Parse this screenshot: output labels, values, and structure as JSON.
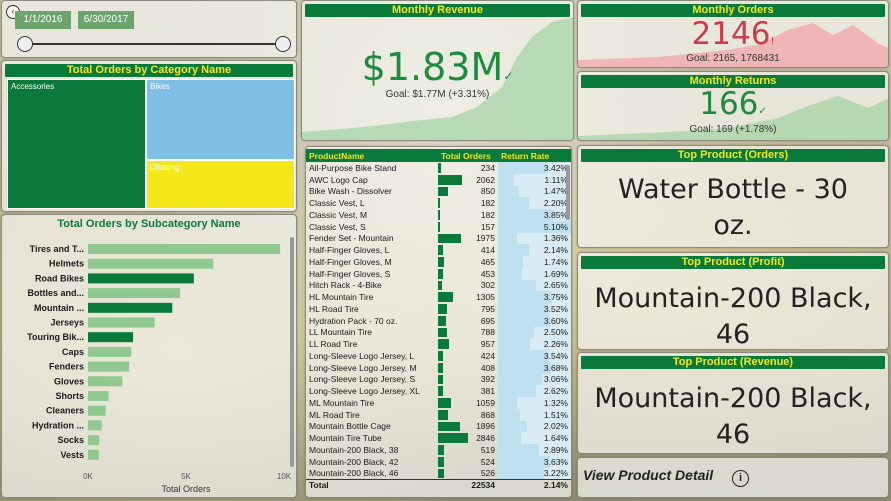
{
  "slicer": {
    "start_date": "1/1/2016",
    "end_date": "6/30/2017"
  },
  "revenue": {
    "title": "Monthly Revenue",
    "value": "$1.83M",
    "goal": "Goal: $1.77M (+3.31%)"
  },
  "orders": {
    "title": "Monthly Orders",
    "value": "2146",
    "goal": "Goal: 2165, 1768431"
  },
  "returns": {
    "title": "Monthly Returns",
    "value": "166",
    "goal": "Goal: 169 (+1.78%)"
  },
  "category": {
    "title": "Total Orders by Category Name",
    "items": [
      "Accessories",
      "Bikes",
      "Clothing"
    ],
    "colors": {
      "accessories": "#0a7a3a",
      "bikes": "#7fbfe6",
      "clothing": "#f4e81a"
    }
  },
  "subcategory": {
    "title": "Total Orders by Subcategory Name",
    "xlabel": "Total Orders",
    "ticks": [
      "0K",
      "5K",
      "10K"
    ]
  },
  "chart_data": {
    "type": "bar",
    "categories": [
      "Tires and T...",
      "Helmets",
      "Road Bikes",
      "Bottles and...",
      "Mountain ...",
      "Jerseys",
      "Touring Bik...",
      "Caps",
      "Fenders",
      "Gloves",
      "Shorts",
      "Cleaners",
      "Hydration ...",
      "Socks",
      "Vests"
    ],
    "values": [
      9800,
      6400,
      5400,
      4700,
      4300,
      3400,
      2300,
      2200,
      2100,
      1750,
      1050,
      900,
      700,
      570,
      550
    ],
    "highlight": [
      false,
      false,
      true,
      false,
      true,
      false,
      true,
      false,
      false,
      false,
      false,
      false,
      false,
      false,
      false
    ],
    "xlabel": "Total Orders",
    "xlim": [
      0,
      10000
    ],
    "ticks": [
      "0K",
      "5K",
      "10K"
    ]
  },
  "product_table": {
    "headers": [
      "ProductName",
      "Total Orders",
      "Return Rate"
    ],
    "max_orders": 2530,
    "max_rr": 5.1,
    "rows": [
      {
        "name": "All-Purpose Bike Stand",
        "orders": "234",
        "orders_num": 234,
        "rr": "3.42%",
        "rr_num": 3.42
      },
      {
        "name": "AWC Logo Cap",
        "orders": "2062",
        "orders_num": 2062,
        "rr": "1.11%",
        "rr_num": 1.11
      },
      {
        "name": "Bike Wash - Dissolver",
        "orders": "850",
        "orders_num": 850,
        "rr": "1.47%",
        "rr_num": 1.47
      },
      {
        "name": "Classic Vest, L",
        "orders": "182",
        "orders_num": 182,
        "rr": "2.20%",
        "rr_num": 2.2
      },
      {
        "name": "Classic Vest, M",
        "orders": "182",
        "orders_num": 182,
        "rr": "3.85%",
        "rr_num": 3.85
      },
      {
        "name": "Classic Vest, S",
        "orders": "157",
        "orders_num": 157,
        "rr": "5.10%",
        "rr_num": 5.1
      },
      {
        "name": "Fender Set - Mountain",
        "orders": "1975",
        "orders_num": 1975,
        "rr": "1.36%",
        "rr_num": 1.36
      },
      {
        "name": "Half-Finger Gloves, L",
        "orders": "414",
        "orders_num": 414,
        "rr": "2.14%",
        "rr_num": 2.14
      },
      {
        "name": "Half-Finger Gloves, M",
        "orders": "465",
        "orders_num": 465,
        "rr": "1.74%",
        "rr_num": 1.74
      },
      {
        "name": "Half-Finger Gloves, S",
        "orders": "453",
        "orders_num": 453,
        "rr": "1.69%",
        "rr_num": 1.69
      },
      {
        "name": "Hitch Rack - 4-Bike",
        "orders": "302",
        "orders_num": 302,
        "rr": "2.65%",
        "rr_num": 2.65
      },
      {
        "name": "HL Mountain Tire",
        "orders": "1305",
        "orders_num": 1305,
        "rr": "3.75%",
        "rr_num": 3.75
      },
      {
        "name": "HL Road Tire",
        "orders": "795",
        "orders_num": 795,
        "rr": "3.52%",
        "rr_num": 3.52
      },
      {
        "name": "Hydration Pack - 70 oz.",
        "orders": "695",
        "orders_num": 695,
        "rr": "3.60%",
        "rr_num": 3.6
      },
      {
        "name": "LL Mountain Tire",
        "orders": "788",
        "orders_num": 788,
        "rr": "2.50%",
        "rr_num": 2.5
      },
      {
        "name": "LL Road Tire",
        "orders": "957",
        "orders_num": 957,
        "rr": "2.26%",
        "rr_num": 2.26
      },
      {
        "name": "Long-Sleeve Logo Jersey, L",
        "orders": "424",
        "orders_num": 424,
        "rr": "3.54%",
        "rr_num": 3.54
      },
      {
        "name": "Long-Sleeve Logo Jersey, M",
        "orders": "408",
        "orders_num": 408,
        "rr": "3.68%",
        "rr_num": 3.68
      },
      {
        "name": "Long-Sleeve Logo Jersey, S",
        "orders": "392",
        "orders_num": 392,
        "rr": "3.06%",
        "rr_num": 3.06
      },
      {
        "name": "Long-Sleeve Logo Jersey, XL",
        "orders": "381",
        "orders_num": 381,
        "rr": "2.62%",
        "rr_num": 2.62
      },
      {
        "name": "ML Mountain Tire",
        "orders": "1059",
        "orders_num": 1059,
        "rr": "1.32%",
        "rr_num": 1.32
      },
      {
        "name": "ML Road Tire",
        "orders": "868",
        "orders_num": 868,
        "rr": "1.51%",
        "rr_num": 1.51
      },
      {
        "name": "Mountain Bottle Cage",
        "orders": "1896",
        "orders_num": 1896,
        "rr": "2.02%",
        "rr_num": 2.02
      },
      {
        "name": "Mountain Tire Tube",
        "orders": "2846",
        "orders_num": 2846,
        "rr": "1.64%",
        "rr_num": 1.64
      },
      {
        "name": "Mountain-200 Black, 38",
        "orders": "519",
        "orders_num": 519,
        "rr": "2.89%",
        "rr_num": 2.89
      },
      {
        "name": "Mountain-200 Black, 42",
        "orders": "524",
        "orders_num": 524,
        "rr": "3.63%",
        "rr_num": 3.63
      },
      {
        "name": "Mountain-200 Black, 46",
        "orders": "526",
        "orders_num": 526,
        "rr": "3.22%",
        "rr_num": 3.22
      }
    ],
    "total": {
      "label": "Total",
      "orders": "22534",
      "rr": "2.14%"
    }
  },
  "top_orders": {
    "title": "Top Product (Orders)",
    "value": "Water Bottle - 30 oz."
  },
  "top_profit": {
    "title": "Top Product (Profit)",
    "value": "Mountain-200 Black, 46"
  },
  "top_revenue": {
    "title": "Top Product (Revenue)",
    "value": "Mountain-200 Black, 46"
  },
  "detail": {
    "label": "View Product Detail",
    "icon": "info-icon"
  }
}
